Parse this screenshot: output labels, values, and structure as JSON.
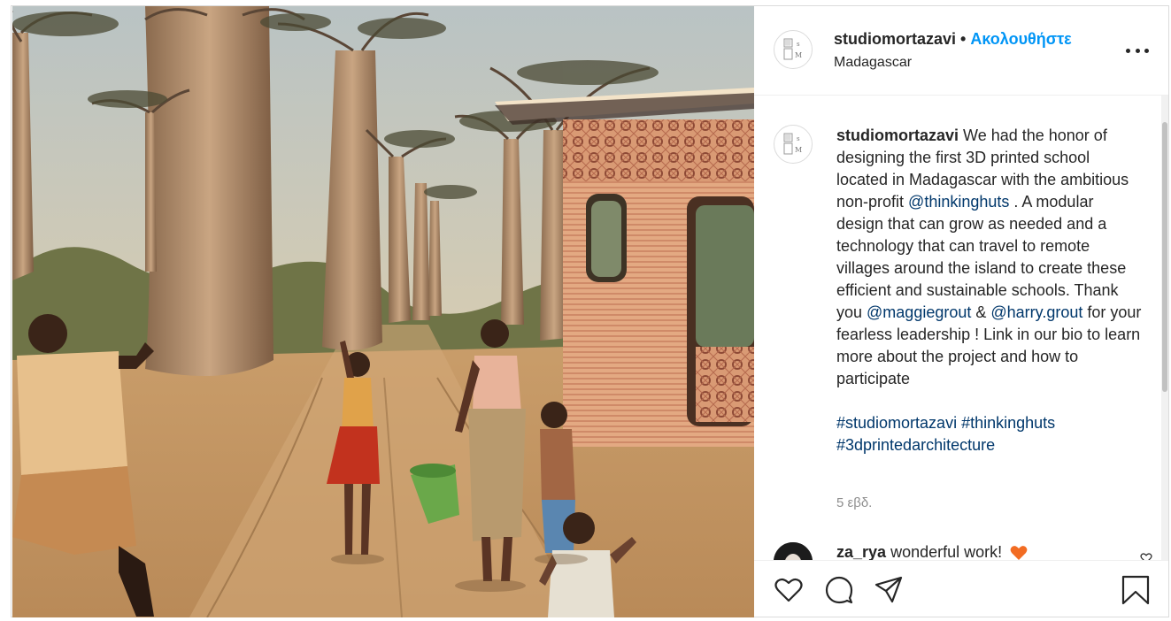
{
  "post": {
    "username": "studiomortazavi",
    "separator": "•",
    "follow_label": "Ακολουθήστε",
    "location": "Madagascar",
    "more_label": "More options"
  },
  "caption": {
    "username": "studiomortazavi",
    "text_1": " We had the honor of designing the first 3D printed school located in Madagascar with the ambitious non-profit ",
    "mention_1": "@thinkinghuts",
    "text_2": " . A modular design that can grow as needed and a technology that can travel to remote villages around the island to create these efficient and sustainable schools. Thank you ",
    "mention_2": "@maggiegrout",
    "text_3": " & ",
    "mention_3": "@harry.grout",
    "text_4": " for your fearless leadership ! Link in our bio to learn more about the project and how to participate",
    "hashtag_1": "#studiomortazavi",
    "hashtag_2": "#thinkinghuts",
    "hashtag_3": "#3dprintedarchitecture",
    "time": "5 εβδ."
  },
  "comment": {
    "username": "za_rya",
    "text": " wonderful work!",
    "emoji": "orange-heart"
  },
  "avatar_logo": {
    "letter_s": "s",
    "letter_m": "M"
  },
  "actions": [
    {
      "name": "like",
      "icon": "heart-icon"
    },
    {
      "name": "comment",
      "icon": "comment-icon"
    },
    {
      "name": "share",
      "icon": "share-icon"
    },
    {
      "name": "save",
      "icon": "bookmark-icon"
    }
  ],
  "colors": {
    "follow_blue": "#0095f6",
    "link_blue": "#00376b",
    "text": "#262626",
    "muted": "#8e8e8e",
    "emoji_orange": "#f26c23"
  }
}
